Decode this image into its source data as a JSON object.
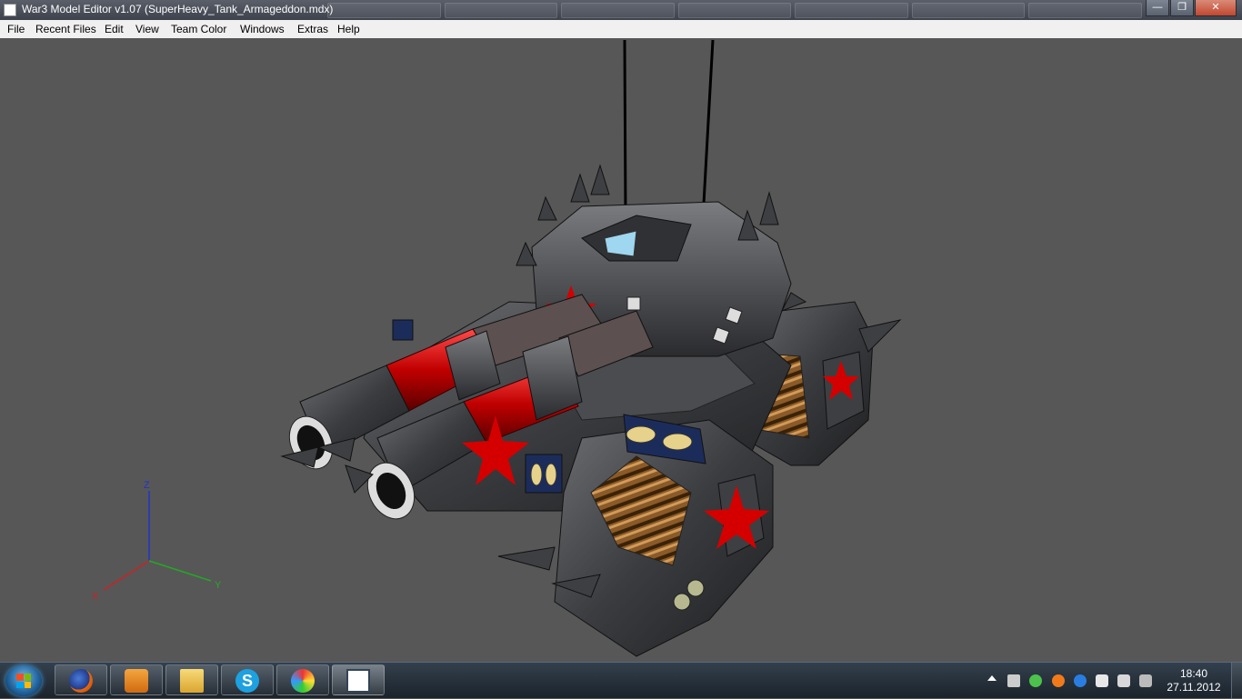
{
  "window": {
    "title": "War3 Model Editor v1.07 (SuperHeavy_Tank_Armageddon.mdx)",
    "minimize_label": "—",
    "maximize_label": "❐",
    "close_label": "✕"
  },
  "menu": {
    "items": [
      "File",
      "Recent Files",
      "Edit",
      "View",
      "Team Color",
      "Windows",
      "Extras",
      "Help"
    ]
  },
  "viewport": {
    "background": "#575757",
    "axes": {
      "z_label": "Z",
      "x_label": "X",
      "y_label": "Y",
      "z_color": "#2233cc",
      "x_color": "#cc2222",
      "y_color": "#22aa22"
    },
    "model": "tank-model"
  },
  "taskbar": {
    "apps": [
      "firefox-icon",
      "media-player-icon",
      "file-explorer-icon",
      "skype-icon",
      "paint-icon",
      "model-editor-icon"
    ],
    "tray_icons": [
      "show-hidden-icons-icon",
      "volume-icon",
      "green-app-icon",
      "orange-app-icon",
      "blue-app-icon",
      "network-flag-icon",
      "battery-icon",
      "action-center-icon"
    ],
    "clock": {
      "time": "18:40",
      "date": "27.11.2012"
    }
  }
}
